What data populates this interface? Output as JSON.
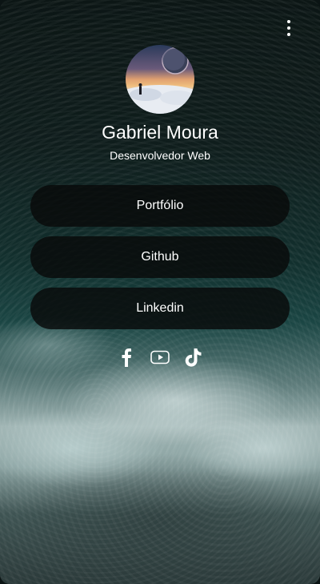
{
  "profile": {
    "name": "Gabriel Moura",
    "role": "Desenvolvedor Web"
  },
  "links": [
    {
      "label": "Portfólio"
    },
    {
      "label": "Github"
    },
    {
      "label": "Linkedin"
    }
  ],
  "socials": [
    {
      "icon": "facebook-icon"
    },
    {
      "icon": "youtube-icon"
    },
    {
      "icon": "tiktok-icon"
    }
  ],
  "menu": {
    "icon": "more-vertical-icon"
  },
  "colors": {
    "button_background": "#0a0c0c",
    "text": "#ffffff"
  }
}
